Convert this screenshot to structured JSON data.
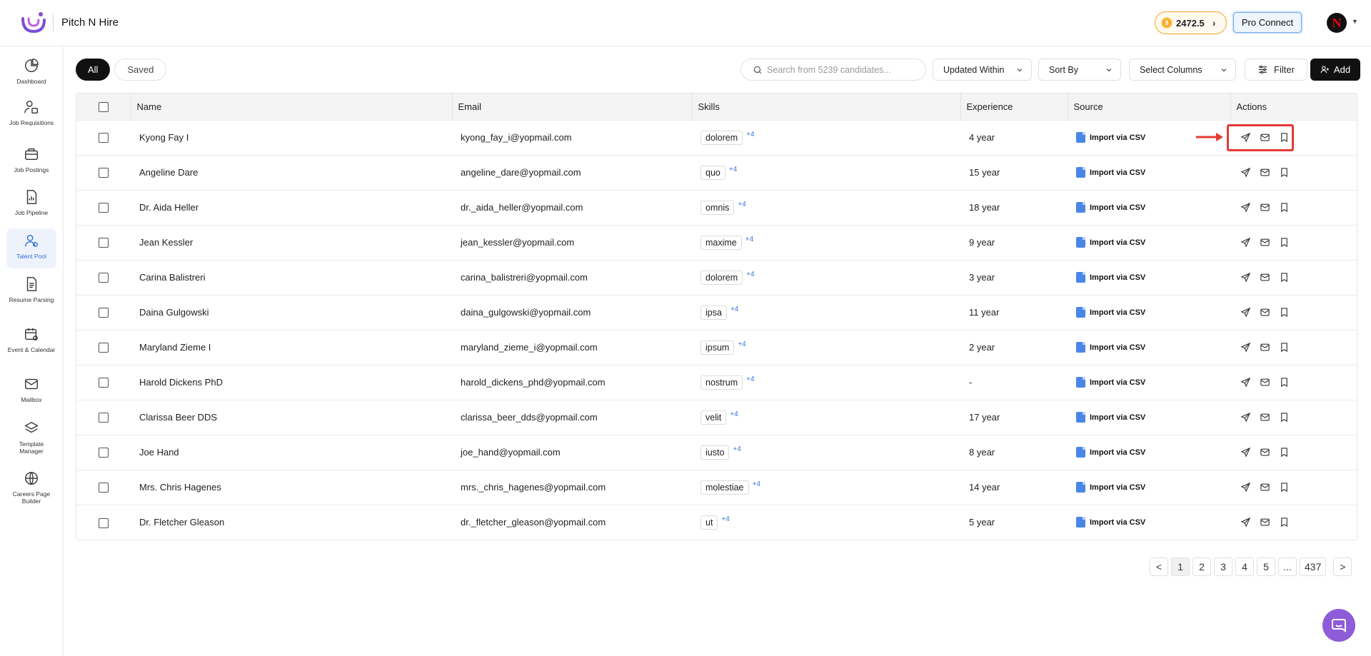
{
  "app": {
    "brand": "Pitch N Hire",
    "coins": "2472.5",
    "pro_connect": "Pro Connect",
    "avatar_letter": "N"
  },
  "sidebar": {
    "items": [
      {
        "label": "Dashboard",
        "icon": "dashboard-icon"
      },
      {
        "label": "Job Requisitions",
        "icon": "job-requisitions-icon"
      },
      {
        "label": "Job Postings",
        "icon": "briefcase-icon"
      },
      {
        "label": "Job Pipeline",
        "icon": "pipeline-icon"
      },
      {
        "label": "Talent Pool",
        "icon": "users-icon",
        "active": true
      },
      {
        "label": "Resume Parsing",
        "icon": "resume-icon"
      },
      {
        "label": "Event & Calendar",
        "icon": "calendar-icon"
      },
      {
        "label": "Mailbox",
        "icon": "mail-icon"
      },
      {
        "label": "Template Manager",
        "icon": "layers-icon"
      },
      {
        "label": "Careers Page Builder",
        "icon": "globe-icon"
      }
    ]
  },
  "toolbar": {
    "tab_all": "All",
    "tab_saved": "Saved",
    "search_placeholder": "Search from 5239 candidates...",
    "updated_within": "Updated Within",
    "sort_by": "Sort By",
    "select_columns": "Select Columns",
    "filter": "Filter",
    "add": "Add"
  },
  "table": {
    "headers": [
      "Name",
      "Email",
      "Skills",
      "Experience",
      "Source",
      "Actions"
    ],
    "rows": [
      {
        "name": "Kyong Fay I",
        "email": "kyong_fay_i@yopmail.com",
        "skill": "dolorem",
        "more": "+4",
        "experience": "4 year",
        "source": "Import via CSV"
      },
      {
        "name": "Angeline Dare",
        "email": "angeline_dare@yopmail.com",
        "skill": "quo",
        "more": "+4",
        "experience": "15 year",
        "source": "Import via CSV"
      },
      {
        "name": "Dr. Aida Heller",
        "email": "dr._aida_heller@yopmail.com",
        "skill": "omnis",
        "more": "+4",
        "experience": "18 year",
        "source": "Import via CSV"
      },
      {
        "name": "Jean Kessler",
        "email": "jean_kessler@yopmail.com",
        "skill": "maxime",
        "more": "+4",
        "experience": "9 year",
        "source": "Import via CSV"
      },
      {
        "name": "Carina Balistreri",
        "email": "carina_balistreri@yopmail.com",
        "skill": "dolorem",
        "more": "+4",
        "experience": "3 year",
        "source": "Import via CSV"
      },
      {
        "name": "Daina Gulgowski",
        "email": "daina_gulgowski@yopmail.com",
        "skill": "ipsa",
        "more": "+4",
        "experience": "11 year",
        "source": "Import via CSV"
      },
      {
        "name": "Maryland Zieme I",
        "email": "maryland_zieme_i@yopmail.com",
        "skill": "ipsum",
        "more": "+4",
        "experience": "2 year",
        "source": "Import via CSV"
      },
      {
        "name": "Harold Dickens PhD",
        "email": "harold_dickens_phd@yopmail.com",
        "skill": "nostrum",
        "more": "+4",
        "experience": "-",
        "source": "Import via CSV"
      },
      {
        "name": "Clarissa Beer DDS",
        "email": "clarissa_beer_dds@yopmail.com",
        "skill": "velit",
        "more": "+4",
        "experience": "17 year",
        "source": "Import via CSV"
      },
      {
        "name": "Joe Hand",
        "email": "joe_hand@yopmail.com",
        "skill": "iusto",
        "more": "+4",
        "experience": "8 year",
        "source": "Import via CSV"
      },
      {
        "name": "Mrs. Chris Hagenes",
        "email": "mrs._chris_hagenes@yopmail.com",
        "skill": "molestiae",
        "more": "+4",
        "experience": "14 year",
        "source": "Import via CSV"
      },
      {
        "name": "Dr. Fletcher Gleason",
        "email": "dr._fletcher_gleason@yopmail.com",
        "skill": "ut",
        "more": "+4",
        "experience": "5 year",
        "source": "Import via CSV"
      }
    ]
  },
  "pagination": {
    "prev": "<",
    "pages": [
      "1",
      "2",
      "3",
      "4",
      "5",
      "...",
      "437"
    ],
    "current": "1",
    "next": ">"
  },
  "colors": {
    "accent": "#2f6fd6",
    "highlight": "#e53935",
    "chat": "#8e5cd9",
    "coin": "#f5a623"
  }
}
